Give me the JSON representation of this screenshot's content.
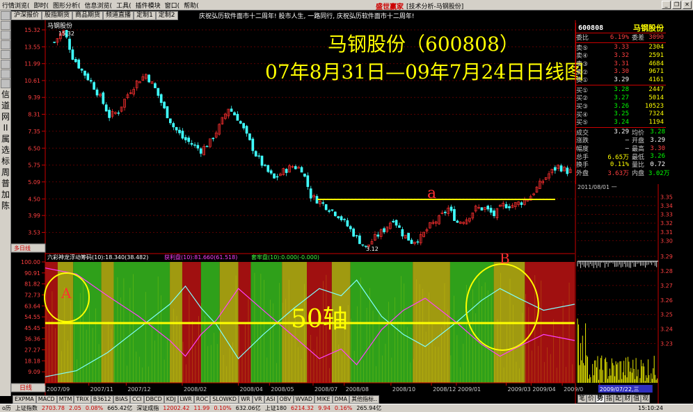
{
  "menubar": {
    "items": [
      "行情浏览(",
      "即时(",
      "图形分析(",
      "信息浏览(",
      "工具(",
      "插件模块",
      "窗口(",
      "帮助("
    ],
    "app_title": "盛世赢家",
    "window_title": "[技术分析-马钢股份]"
  },
  "tabs": [
    "沪深报价",
    "股指期货",
    "商品期货",
    "频道直播",
    "定制1",
    "定制2"
  ],
  "ticker": "庆祝弘历软件面市十二周年!    股市人生, 一路同行, 庆祝弘历软件面市十二周年!",
  "left_toolbar": [
    "信",
    "道",
    "网",
    "II",
    "属",
    "选",
    "标",
    "周",
    "普",
    "加",
    "陈"
  ],
  "chart_title": "马钢股份",
  "annotation": {
    "line1": "马钢股份（600808）",
    "line2": "07年8月31日—09年7月24日日线图",
    "a": "a",
    "A": "A",
    "B": "B",
    "axis50": "50轴",
    "low_label": "3.12",
    "high_label": "15.32"
  },
  "chart_data": [
    {
      "type": "candlestick",
      "y_ticks": [
        "15.32",
        "13.55",
        "11.99",
        "10.61",
        "9.39",
        "8.31",
        "7.35",
        "6.50",
        "5.75",
        "5.09",
        "4.50",
        "3.99",
        "3.53"
      ],
      "ylim": [
        3.12,
        15.32
      ],
      "scale": "log",
      "close_path": [
        [
          0,
          14.0
        ],
        [
          3,
          15.32
        ],
        [
          6,
          12.6
        ],
        [
          9,
          11.4
        ],
        [
          12,
          10.5
        ],
        [
          15,
          9.4
        ],
        [
          18,
          8.2
        ],
        [
          21,
          8.5
        ],
        [
          24,
          9.6
        ],
        [
          27,
          10.5
        ],
        [
          30,
          11.1
        ],
        [
          33,
          10.0
        ],
        [
          36,
          8.6
        ],
        [
          39,
          7.6
        ],
        [
          42,
          7.0
        ],
        [
          45,
          6.7
        ],
        [
          48,
          6.4
        ],
        [
          51,
          6.8
        ],
        [
          54,
          7.6
        ],
        [
          57,
          8.7
        ],
        [
          60,
          8.1
        ],
        [
          63,
          7.1
        ],
        [
          66,
          6.2
        ],
        [
          69,
          5.6
        ],
        [
          72,
          5.2
        ],
        [
          75,
          5.5
        ],
        [
          78,
          5.7
        ],
        [
          81,
          5.6
        ],
        [
          84,
          4.6
        ],
        [
          87,
          4.4
        ],
        [
          90,
          4.2
        ],
        [
          93,
          4.0
        ],
        [
          96,
          3.7
        ],
        [
          99,
          3.4
        ],
        [
          102,
          3.15
        ],
        [
          105,
          3.4
        ],
        [
          108,
          3.6
        ],
        [
          111,
          3.9
        ],
        [
          114,
          3.5
        ],
        [
          117,
          3.3
        ],
        [
          120,
          3.4
        ],
        [
          123,
          3.7
        ],
        [
          126,
          3.9
        ],
        [
          129,
          4.2
        ],
        [
          132,
          3.8
        ],
        [
          135,
          3.9
        ],
        [
          138,
          4.2
        ],
        [
          141,
          4.2
        ],
        [
          144,
          4.0
        ],
        [
          147,
          4.3
        ],
        [
          150,
          4.3
        ],
        [
          153,
          4.4
        ],
        [
          156,
          4.6
        ],
        [
          159,
          5.0
        ],
        [
          162,
          5.4
        ],
        [
          165,
          5.7
        ],
        [
          168,
          5.5
        ]
      ],
      "series_n": 170,
      "line_a_level": 4.55
    },
    {
      "type": "area",
      "indicator": "六彩神龙",
      "legend": [
        {
          "text": "浮动筹码(10):18.340(38.482)",
          "color": "#ffffff"
        },
        {
          "text": "获利盘(10):81.660(61.518)",
          "color": "#ff40ff"
        },
        {
          "text": "套牢盘(10):0.000(-0.000)",
          "color": "#40ff40"
        }
      ],
      "y_ticks": [
        "100.00",
        "90.91",
        "81.82",
        "72.73",
        "63.64",
        "54.55",
        "45.45",
        "36.36",
        "27.27",
        "18.18",
        "9.09"
      ],
      "ylim": [
        0,
        100
      ],
      "axis50": 50,
      "bands": [
        [
          0,
          "r"
        ],
        [
          4,
          "y"
        ],
        [
          9,
          "g"
        ],
        [
          18,
          "y"
        ],
        [
          22,
          "g"
        ],
        [
          40,
          "y"
        ],
        [
          44,
          "r"
        ],
        [
          50,
          "g"
        ],
        [
          56,
          "y"
        ],
        [
          62,
          "r"
        ],
        [
          66,
          "g"
        ],
        [
          76,
          "y"
        ],
        [
          84,
          "r"
        ],
        [
          92,
          "y"
        ],
        [
          98,
          "g"
        ],
        [
          118,
          "y"
        ],
        [
          130,
          "g"
        ],
        [
          144,
          "y"
        ],
        [
          154,
          "r"
        ],
        [
          170,
          "r"
        ]
      ],
      "cyan": [
        [
          0,
          5
        ],
        [
          10,
          10
        ],
        [
          20,
          25
        ],
        [
          30,
          45
        ],
        [
          40,
          65
        ],
        [
          45,
          80
        ],
        [
          50,
          62
        ],
        [
          55,
          48
        ],
        [
          62,
          20
        ],
        [
          70,
          40
        ],
        [
          80,
          62
        ],
        [
          88,
          78
        ],
        [
          95,
          72
        ],
        [
          100,
          85
        ],
        [
          108,
          55
        ],
        [
          115,
          40
        ],
        [
          122,
          30
        ],
        [
          132,
          50
        ],
        [
          140,
          68
        ],
        [
          146,
          78
        ],
        [
          152,
          70
        ],
        [
          160,
          60
        ],
        [
          170,
          65
        ]
      ],
      "magenta": [
        [
          0,
          95
        ],
        [
          10,
          90
        ],
        [
          20,
          72
        ],
        [
          30,
          55
        ],
        [
          40,
          35
        ],
        [
          45,
          22
        ],
        [
          50,
          40
        ],
        [
          55,
          52
        ],
        [
          62,
          78
        ],
        [
          70,
          60
        ],
        [
          80,
          38
        ],
        [
          88,
          20
        ],
        [
          95,
          28
        ],
        [
          100,
          15
        ],
        [
          108,
          44
        ],
        [
          115,
          60
        ],
        [
          122,
          70
        ],
        [
          132,
          50
        ],
        [
          140,
          32
        ],
        [
          146,
          22
        ],
        [
          152,
          30
        ],
        [
          160,
          40
        ],
        [
          170,
          35
        ]
      ],
      "x_dates": [
        "2007/09",
        "2007/11",
        "2007/12",
        "2008/02",
        "2008/04",
        "2008/05",
        "2008/07",
        "2008/08",
        "2008/10",
        "2008/12",
        "2009/01",
        "2009/03",
        "2009/04",
        "2009/0",
        "2009/07/22,三"
      ]
    },
    {
      "type": "line",
      "date": "2011/08/01 一",
      "y_ticks": [
        "3.35",
        "3.34",
        "3.33",
        "3.32",
        "3.31",
        "3.30",
        "3.29",
        "3.28",
        "3.27",
        "3.26",
        "3.25",
        "3.24",
        "3.23"
      ],
      "ylim": [
        3.225,
        3.355
      ]
    }
  ],
  "quote": {
    "code": "600808",
    "name": "马钢股份",
    "header": {
      "label1": "委比",
      "val1": "6.19%",
      "label2": "委差",
      "val2": "3090"
    },
    "sells": [
      {
        "label": "卖⑤",
        "price": "3.33",
        "vol": "2304"
      },
      {
        "label": "卖④",
        "price": "3.32",
        "vol": "2591"
      },
      {
        "label": "卖③",
        "price": "3.31",
        "vol": "4684"
      },
      {
        "label": "卖②",
        "price": "3.30",
        "vol": "9671"
      },
      {
        "label": "卖①",
        "price": "3.29",
        "vol": "4161"
      }
    ],
    "buys": [
      {
        "label": "买①",
        "price": "3.28",
        "vol": "2447"
      },
      {
        "label": "买②",
        "price": "3.27",
        "vol": "5014"
      },
      {
        "label": "买③",
        "price": "3.26",
        "vol": "10523"
      },
      {
        "label": "买④",
        "price": "3.25",
        "vol": "7324"
      },
      {
        "label": "买⑤",
        "price": "3.24",
        "vol": "1194"
      }
    ],
    "stats": [
      {
        "l1": "成交",
        "v1": "3.29",
        "c1": "w",
        "l2": "均价",
        "v2": "3.28",
        "c2": "g"
      },
      {
        "l1": "涨跌",
        "v1": "",
        "c1": "w",
        "l2": "开盘",
        "v2": "3.29",
        "c2": "w",
        "pre2": "—"
      },
      {
        "l1": "幅度",
        "v1": "",
        "c1": "w",
        "l2": "最高",
        "v2": "3.30",
        "c2": "r",
        "pre2": "—"
      },
      {
        "l1": "总手",
        "v1": "6.65万",
        "c1": "y",
        "l2": "最低",
        "v2": "3.26",
        "c2": "g"
      },
      {
        "l1": "换手",
        "v1": "0.11%",
        "c1": "y",
        "l2": "量比",
        "v2": "0.72",
        "c2": "w"
      },
      {
        "l1": "外盘",
        "v1": "3.63万",
        "c1": "r",
        "l2": "内盘",
        "v2": "3.02万",
        "c2": "g"
      }
    ]
  },
  "right_tabs": [
    "笔",
    "价",
    "势",
    "指",
    "配",
    "财",
    "值",
    "观"
  ],
  "bottom_tabs": [
    "EXPMA",
    "MACD",
    "MTM",
    "TRIX",
    "B3612",
    "BIAS",
    "CCI",
    "DBCD",
    "KDJ",
    "LWR",
    "ROC",
    "SLOWKD",
    "WR",
    "VR",
    "ASI",
    "OBV",
    "WVAD",
    "MIKE",
    "DMA",
    "其他指标.."
  ],
  "side_tags": {
    "top": "多日线",
    "bottom": "日线"
  },
  "status": {
    "sh_label": "上证指数",
    "sh_val": "2703.78",
    "sh_chg": "2.05",
    "sh_pct": "0.08%",
    "sh_amt": "665.42亿",
    "sz_label": "深证成指",
    "sz_val": "12002.42",
    "sz_chg": "11.99",
    "sz_pct": "0.10%",
    "sz_amt": "632.06亿",
    "s180_label": "上证180",
    "s180_val": "6214.32",
    "s180_chg": "9.94",
    "s180_pct": "0.16%",
    "s180_amt": "265.94亿",
    "time": "15:10:24",
    "left_label": "o历"
  },
  "colors": {
    "up": "#ff3030",
    "down": "#40ffff",
    "yellow": "#ffff00",
    "green_band": "#2fa01a",
    "red_band": "#a01010",
    "olive_band": "#a09a10"
  }
}
